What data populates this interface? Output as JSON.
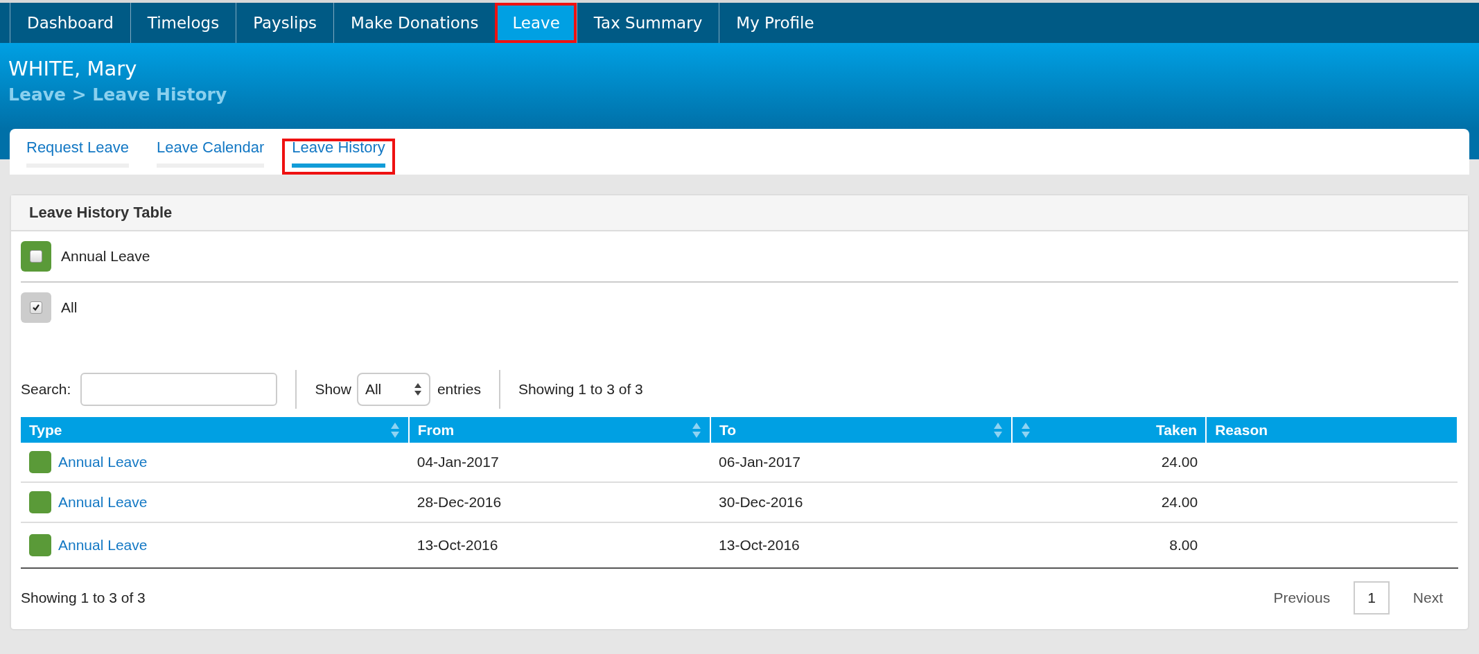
{
  "nav": {
    "items": [
      {
        "label": "Dashboard",
        "selected": false,
        "highlighted": false
      },
      {
        "label": "Timelogs",
        "selected": false,
        "highlighted": false
      },
      {
        "label": "Payslips",
        "selected": false,
        "highlighted": false
      },
      {
        "label": "Make Donations",
        "selected": false,
        "highlighted": false
      },
      {
        "label": "Leave",
        "selected": true,
        "highlighted": true
      },
      {
        "label": "Tax Summary",
        "selected": false,
        "highlighted": false
      },
      {
        "label": "My Profile",
        "selected": false,
        "highlighted": false
      }
    ]
  },
  "header": {
    "name": "WHITE, Mary",
    "breadcrumb": "Leave > Leave History"
  },
  "subtabs": [
    {
      "label": "Request Leave",
      "selected": false,
      "highlighted": false
    },
    {
      "label": "Leave Calendar",
      "selected": false,
      "highlighted": false
    },
    {
      "label": "Leave History",
      "selected": true,
      "highlighted": true
    }
  ],
  "panel": {
    "title": "Leave History Table",
    "filters": [
      {
        "label": "Annual Leave",
        "color": "#5a9a38",
        "checked": false
      },
      {
        "label": "All",
        "color": "#cccccc",
        "checked": true
      }
    ],
    "search": {
      "label": "Search:"
    },
    "length": {
      "before": "Show",
      "value": "All",
      "after": "entries"
    },
    "info": "Showing 1 to 3 of 3",
    "table": {
      "columns": [
        {
          "label": "Type",
          "sortable": true,
          "numeric": false
        },
        {
          "label": "From",
          "sortable": true,
          "numeric": false
        },
        {
          "label": "To",
          "sortable": true,
          "numeric": false
        },
        {
          "label": "Taken",
          "sortable": true,
          "numeric": true
        },
        {
          "label": "Reason",
          "sortable": false,
          "numeric": false
        }
      ],
      "rows": [
        {
          "type": "Annual Leave",
          "color": "#5a9a38",
          "from": "04-Jan-2017",
          "to": "06-Jan-2017",
          "taken": "24.00"
        },
        {
          "type": "Annual Leave",
          "color": "#5a9a38",
          "from": "28-Dec-2016",
          "to": "30-Dec-2016",
          "taken": "24.00"
        },
        {
          "type": "Annual Leave",
          "color": "#5a9a38",
          "from": "13-Oct-2016",
          "to": "13-Oct-2016",
          "taken": "8.00"
        }
      ]
    },
    "footer_info": "Showing 1 to 3 of 3",
    "pagination": {
      "previous": "Previous",
      "pages": [
        {
          "label": "1",
          "selected": true
        }
      ],
      "next": "Next"
    }
  }
}
